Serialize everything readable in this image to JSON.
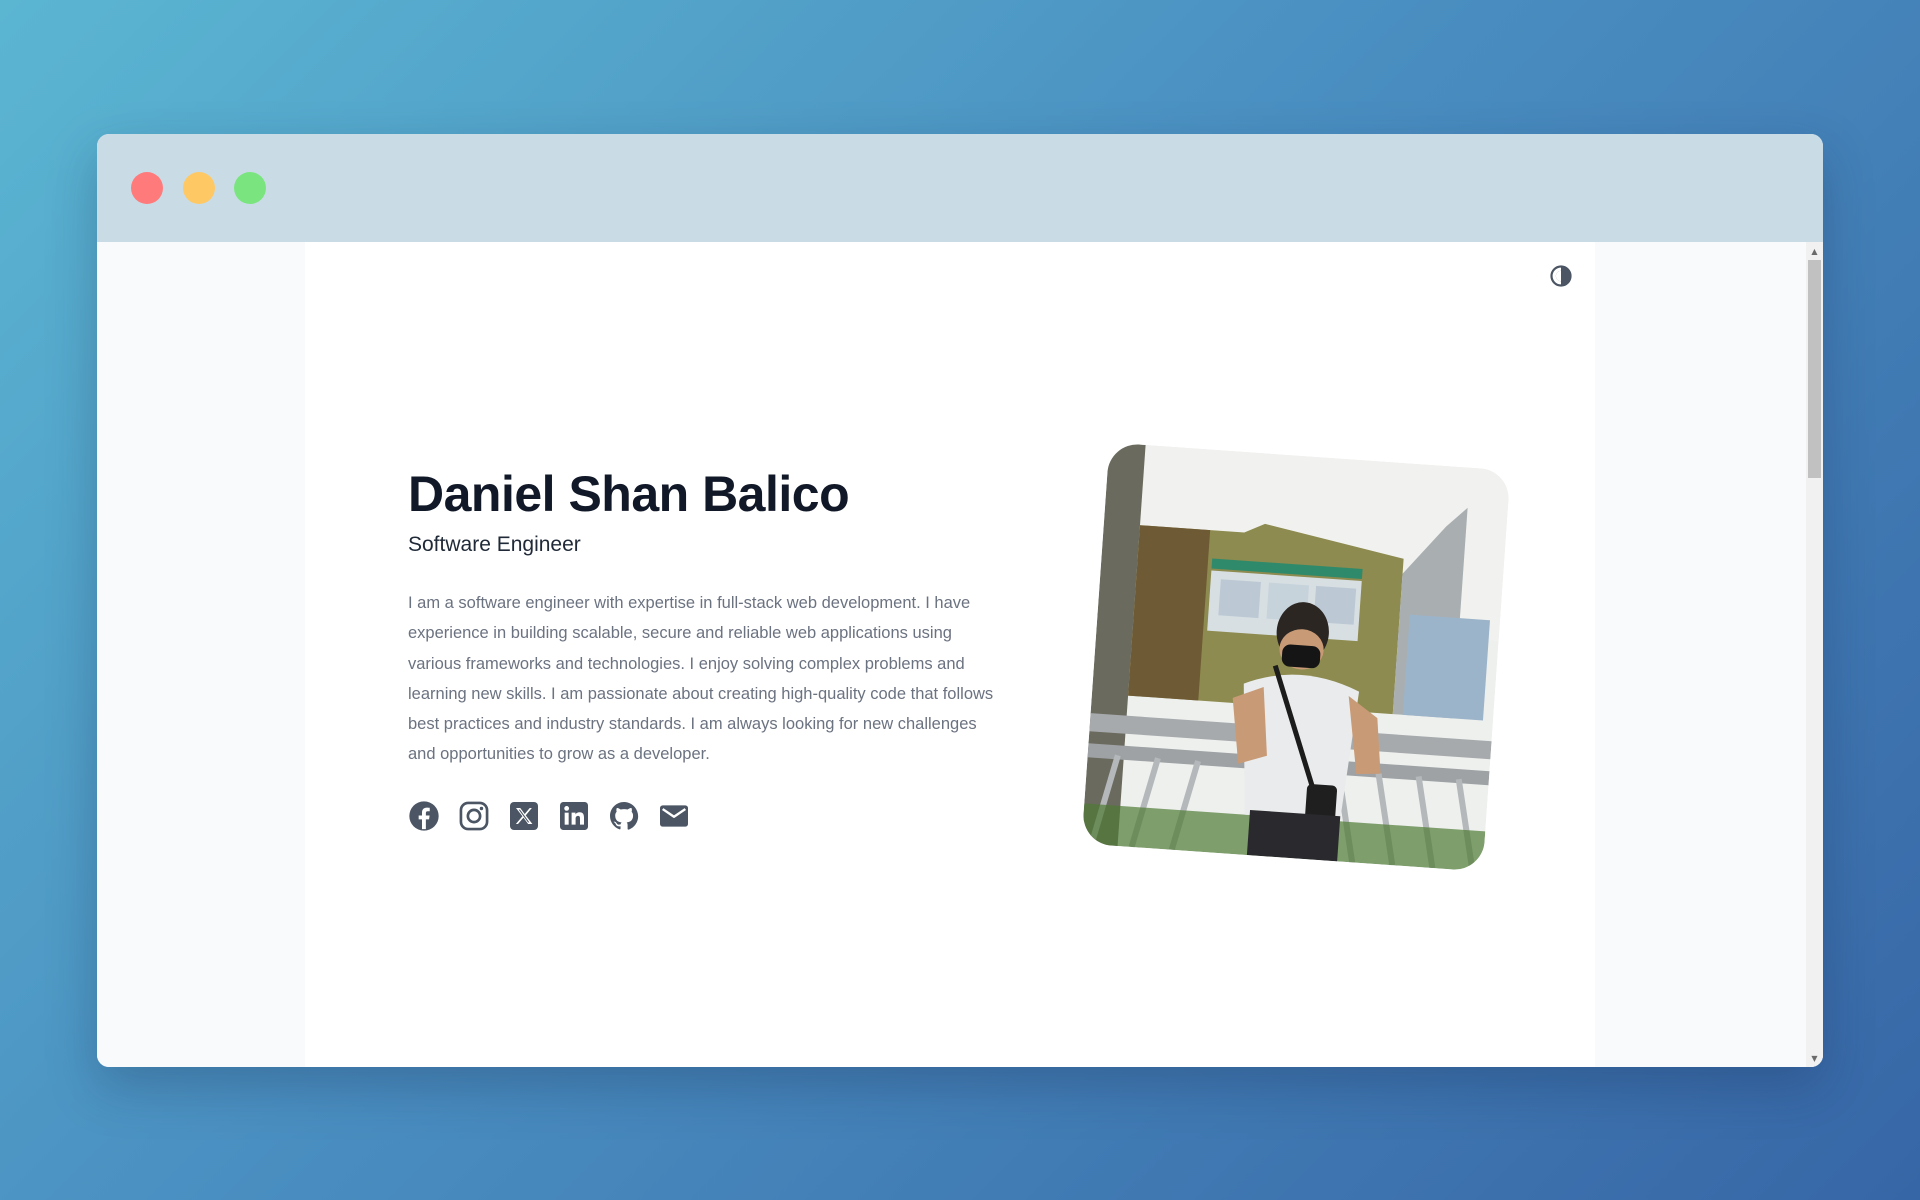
{
  "window": {
    "controls": [
      "close",
      "minimize",
      "maximize"
    ]
  },
  "header": {
    "theme_toggle_icon": "contrast-icon"
  },
  "hero": {
    "name": "Daniel Shan Balico",
    "role": "Software Engineer",
    "bio": "I am a software engineer with expertise in full-stack web development. I have experience in building scalable, secure and reliable web applications using various frameworks and technologies. I enjoy solving complex problems and learning new skills. I am passionate about creating high-quality code that follows best practices and industry standards. I am always looking for new challenges and opportunities to grow as a developer.",
    "socials": [
      {
        "icon": "facebook-icon"
      },
      {
        "icon": "instagram-icon"
      },
      {
        "icon": "x-icon"
      },
      {
        "icon": "linkedin-icon"
      },
      {
        "icon": "github-icon"
      },
      {
        "icon": "email-icon"
      }
    ],
    "photo": {
      "subject": "profile-photo"
    }
  },
  "colors": {
    "heading": "#111827",
    "body": "#6b7280",
    "icons": "#4b5563",
    "titlebar": "#c9dce6"
  }
}
